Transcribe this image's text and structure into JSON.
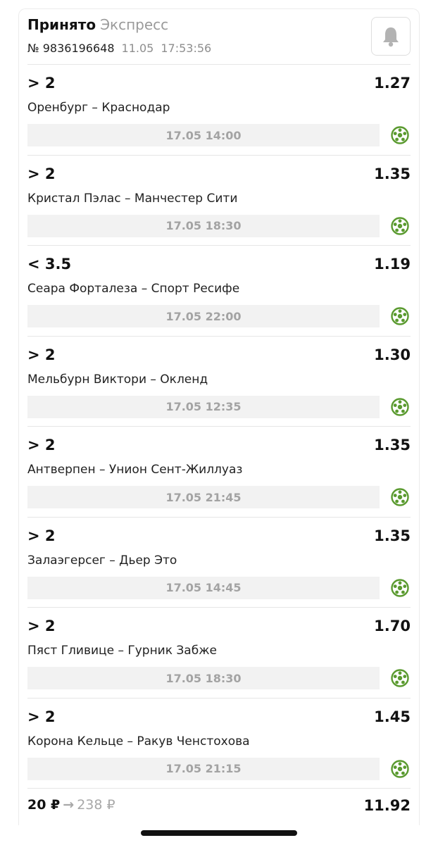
{
  "header": {
    "status": "Принято",
    "bet_type": "Экспресс",
    "bet_number": "№ 9836196648",
    "date": "11.05",
    "time": "17:53:56"
  },
  "bets": [
    {
      "outcome": "> 2",
      "coef": "1.27",
      "match": "Оренбург – Краснодар",
      "datetime": "17.05 14:00"
    },
    {
      "outcome": "> 2",
      "coef": "1.35",
      "match": "Кристал Пэлас – Манчестер Сити",
      "datetime": "17.05 18:30"
    },
    {
      "outcome": "< 3.5",
      "coef": "1.19",
      "match": "Сеара Форталеза – Спорт Ресифе",
      "datetime": "17.05 22:00"
    },
    {
      "outcome": "> 2",
      "coef": "1.30",
      "match": "Мельбурн Виктори – Окленд",
      "datetime": "17.05 12:35"
    },
    {
      "outcome": "> 2",
      "coef": "1.35",
      "match": "Антверпен – Унион Сент-Жиллуаз",
      "datetime": "17.05 21:45"
    },
    {
      "outcome": "> 2",
      "coef": "1.35",
      "match": "Залаэгерсег – Дьер Это",
      "datetime": "17.05 14:45"
    },
    {
      "outcome": "> 2",
      "coef": "1.70",
      "match": "Пяст Гливице – Гурник Забже",
      "datetime": "17.05 18:30"
    },
    {
      "outcome": "> 2",
      "coef": "1.45",
      "match": "Корона Кельце – Ракув Ченстохова",
      "datetime": "17.05 21:15"
    }
  ],
  "footer": {
    "stake": "20 ₽",
    "arrow": "→",
    "potential_win": "238 ₽",
    "total_coef": "11.92"
  },
  "icons": {
    "bell": "bell-icon",
    "sport": "soccer-ball-icon"
  },
  "colors": {
    "soccer_green": "#5a9a2f",
    "muted_text": "#9a9a9a",
    "time_bg": "#f2f2f2"
  }
}
